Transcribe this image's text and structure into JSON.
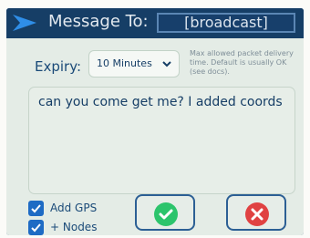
{
  "header": {
    "title": "Message To:",
    "recipient": "[broadcast]",
    "logo_icon": "meshtastic-logo"
  },
  "expiry": {
    "label": "Expiry:",
    "selected": "10 Minutes",
    "help": "Max allowed packet delivery time. Default is usually OK (see docs)."
  },
  "message": {
    "text": "can you come get me? I added coords"
  },
  "options": [
    {
      "label": "Add GPS",
      "checked": true
    },
    {
      "label": "+ Nodes",
      "checked": true
    }
  ],
  "actions": {
    "send_icon": "check-icon",
    "cancel_icon": "close-icon"
  },
  "colors": {
    "header": "#163e66",
    "panel": "#e4ece6",
    "checkbox": "#1e6bc4",
    "send": "#2cc46c",
    "cancel": "#e04242"
  }
}
